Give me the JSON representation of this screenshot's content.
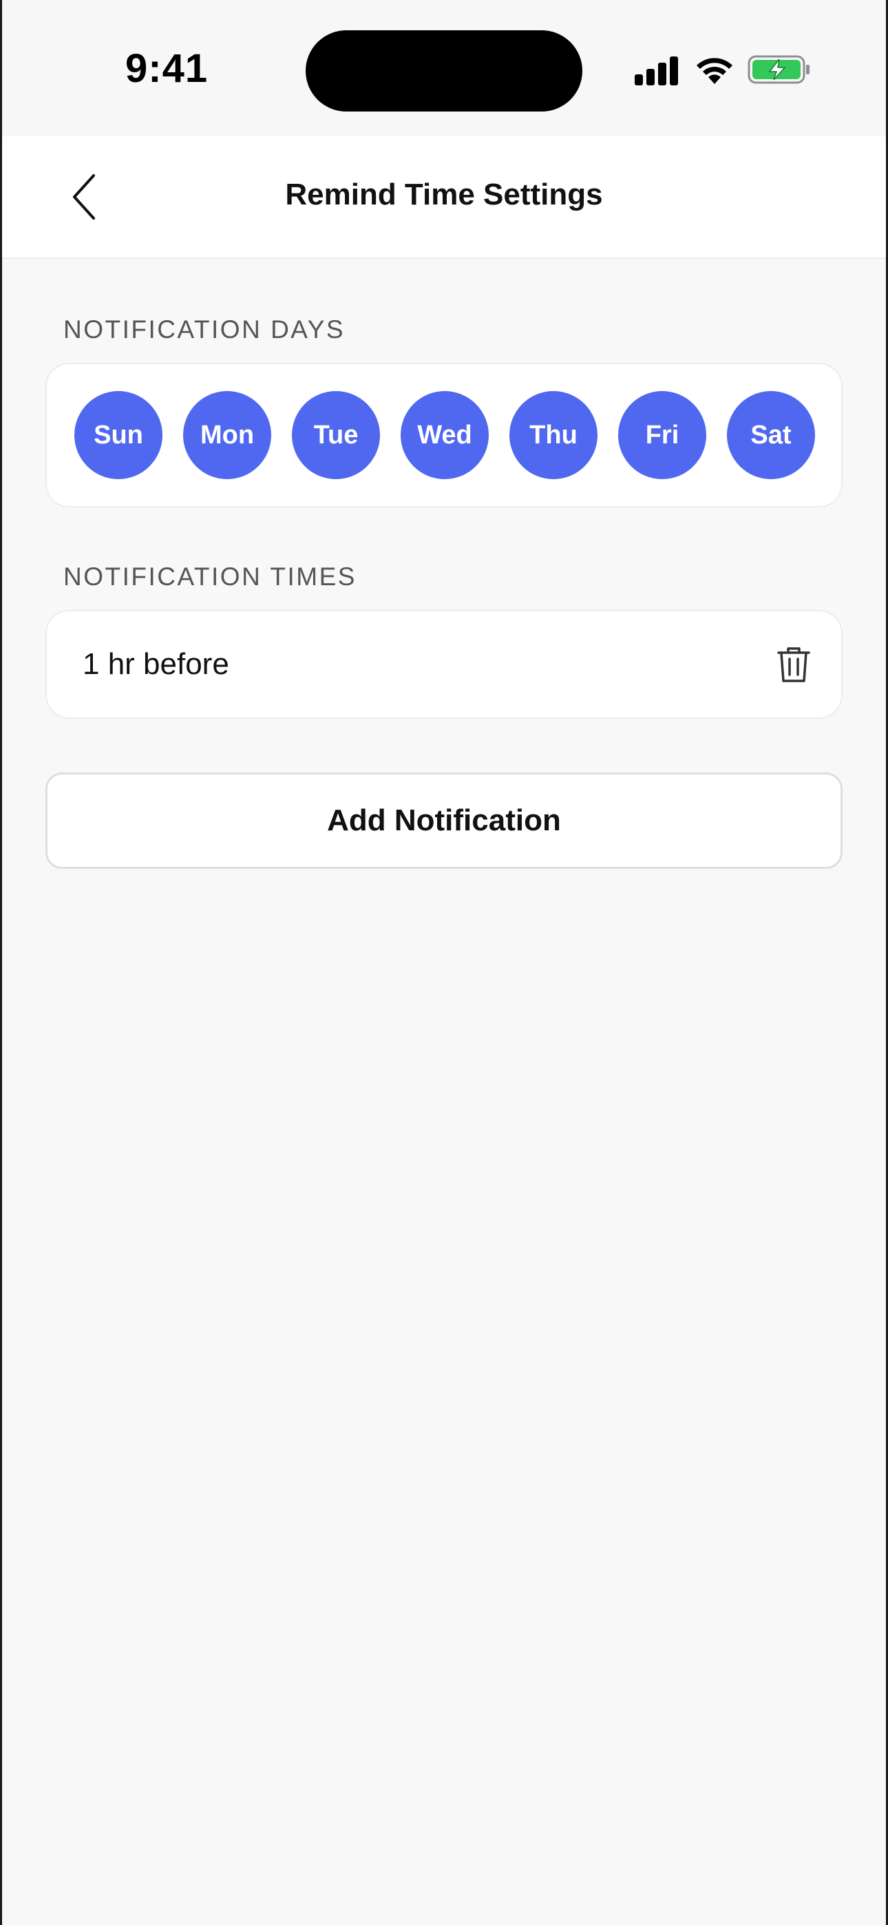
{
  "status_bar": {
    "time": "9:41",
    "icons": [
      "signal-icon",
      "wifi-icon",
      "battery-charging-icon"
    ]
  },
  "nav": {
    "title": "Remind Time Settings",
    "back_icon": "chevron-left-icon"
  },
  "colors": {
    "accent": "#5068f0",
    "background": "#f8f8f8",
    "card": "#ffffff",
    "battery_fill": "#34c759"
  },
  "days_section": {
    "header": "NOTIFICATION DAYS",
    "days": [
      {
        "label": "Sun",
        "selected": true
      },
      {
        "label": "Mon",
        "selected": true
      },
      {
        "label": "Tue",
        "selected": true
      },
      {
        "label": "Wed",
        "selected": true
      },
      {
        "label": "Thu",
        "selected": true
      },
      {
        "label": "Fri",
        "selected": true
      },
      {
        "label": "Sat",
        "selected": true
      }
    ]
  },
  "times_section": {
    "header": "NOTIFICATION TIMES",
    "items": [
      {
        "label": "1 hr before",
        "action_icon": "trash-icon"
      }
    ]
  },
  "add_button": {
    "label": "Add Notification"
  }
}
